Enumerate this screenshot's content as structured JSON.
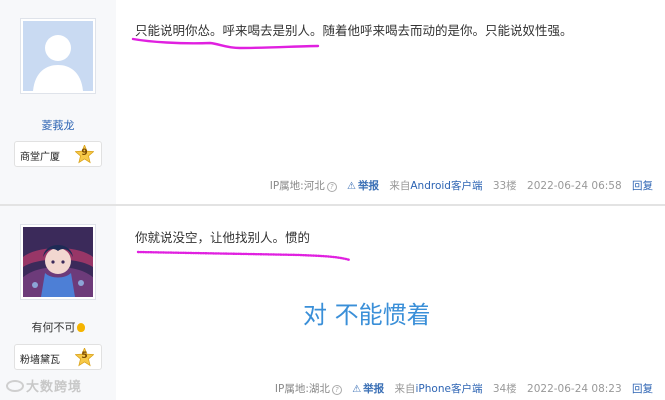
{
  "posts": [
    {
      "username": "菱莪龙",
      "badge": {
        "title": "商堂广厦",
        "level": "9"
      },
      "content": "只能说明你怂。呼来喝去是别人。随着他呼来喝去而动的是你。只能说奴性强。",
      "meta": {
        "ip": "IP属地:河北",
        "report": "举报",
        "client_prefix": "来自",
        "client": "Android客户端",
        "floor": "33楼",
        "time": "2022-06-24 06:58",
        "reply": "回复"
      }
    },
    {
      "username": "有何不可",
      "badge": {
        "title": "粉墙黛瓦",
        "level": "5"
      },
      "content": "你就说没空，让他找别人。惯的",
      "overlay_text": "对 不能惯着",
      "meta": {
        "ip": "IP属地:湖北",
        "report": "举报",
        "client_prefix": "来自",
        "client": "iPhone客户端",
        "floor": "34楼",
        "time": "2022-06-24 08:23",
        "reply": "回复"
      }
    }
  ],
  "watermark": "大数跨境",
  "colors": {
    "link_blue": "#2d64b3",
    "annotation_magenta": "#e020e0",
    "overlay_text_blue": "#3a8fd8",
    "badge_star": "#f7c948"
  },
  "icons": [
    "default-avatar-icon",
    "anime-avatar-image",
    "level-star-icon",
    "help-circle-icon",
    "warning-triangle-icon",
    "coin-icon"
  ]
}
